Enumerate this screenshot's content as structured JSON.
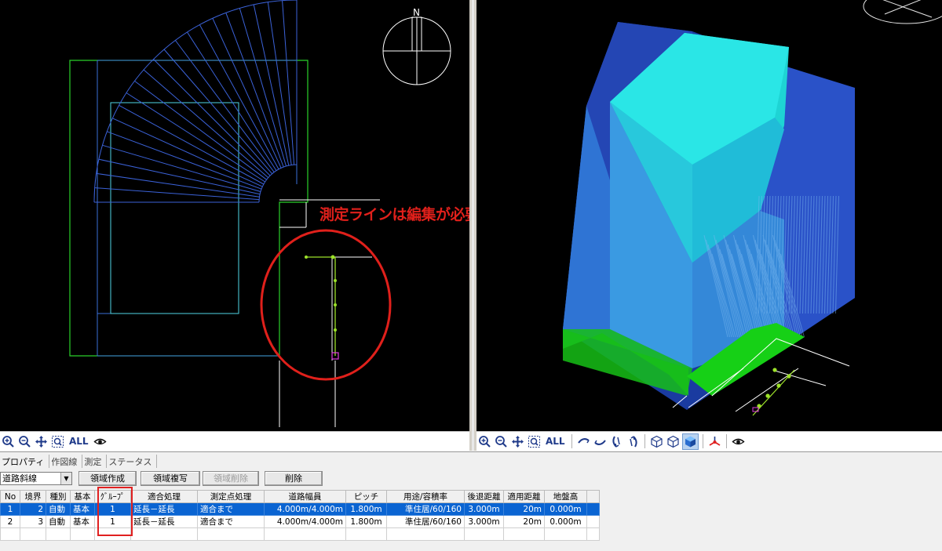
{
  "annotation": {
    "text": "測定ラインは編集が必要です",
    "color": "#e0201b"
  },
  "compass": {
    "label": "N"
  },
  "toolbar_left": {
    "all_label": "ALL"
  },
  "toolbar_right": {
    "all_label": "ALL"
  },
  "panel": {
    "tabs": [
      "プロパティ",
      "作図線",
      "測定",
      "ステータス"
    ],
    "select_value": "道路斜線",
    "buttons": {
      "create": "領域作成",
      "copy": "領域複写",
      "delete_area": "領域削除",
      "delete": "削除"
    }
  },
  "table": {
    "headers": [
      "No",
      "境界",
      "種別",
      "基本",
      "ｸﾞﾙｰﾌﾟ",
      "適合処理",
      "測定点処理",
      "道路幅員",
      "ピッチ",
      "用途/容積率",
      "後退距離",
      "適用距離",
      "地盤高",
      ""
    ],
    "rows": [
      [
        "1",
        "2",
        "自動",
        "基本",
        "1",
        "延長－延長",
        "適合まで",
        "4.000m/4.000m",
        "1.800m",
        "準住居/60/160",
        "3.000m",
        "20m",
        "0.000m",
        ""
      ],
      [
        "2",
        "3",
        "自動",
        "基本",
        "1",
        "延長－延長",
        "適合まで",
        "4.000m/4.000m",
        "1.800m",
        "準住居/60/160",
        "3.000m",
        "20m",
        "0.000m",
        ""
      ]
    ]
  },
  "colors": {
    "highlight": "#e02020",
    "selection": "#0a64d2",
    "cyan_volume": "#1ed4d4",
    "ground": "#16c016"
  }
}
